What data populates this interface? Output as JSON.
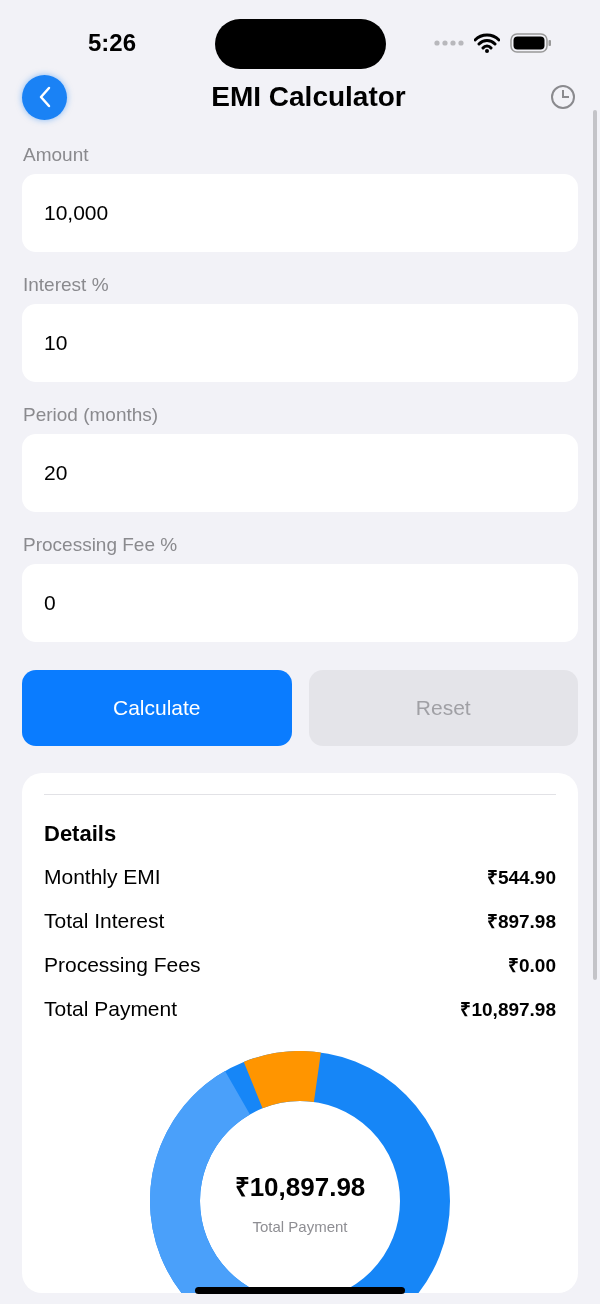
{
  "status_bar": {
    "time": "5:26"
  },
  "nav": {
    "title": "EMI Calculator"
  },
  "fields": [
    {
      "label": "Amount",
      "value": "10,000"
    },
    {
      "label": "Interest %",
      "value": "10"
    },
    {
      "label": "Period (months)",
      "value": "20"
    },
    {
      "label": "Processing Fee %",
      "value": "0"
    }
  ],
  "buttons": [
    {
      "label": "Calculate",
      "kind": "primary"
    },
    {
      "label": "Reset",
      "kind": "disabled"
    }
  ],
  "details": {
    "title": "Details",
    "rows": [
      {
        "label": "Monthly EMI",
        "value": "₹544.90"
      },
      {
        "label": "Total Interest",
        "value": "₹897.98"
      },
      {
        "label": "Processing Fees",
        "value": "₹0.00"
      },
      {
        "label": "Total Payment",
        "value": "₹10,897.98"
      }
    ]
  },
  "summary": {
    "amount": "₹10,897.98",
    "caption": "Total Payment"
  }
}
